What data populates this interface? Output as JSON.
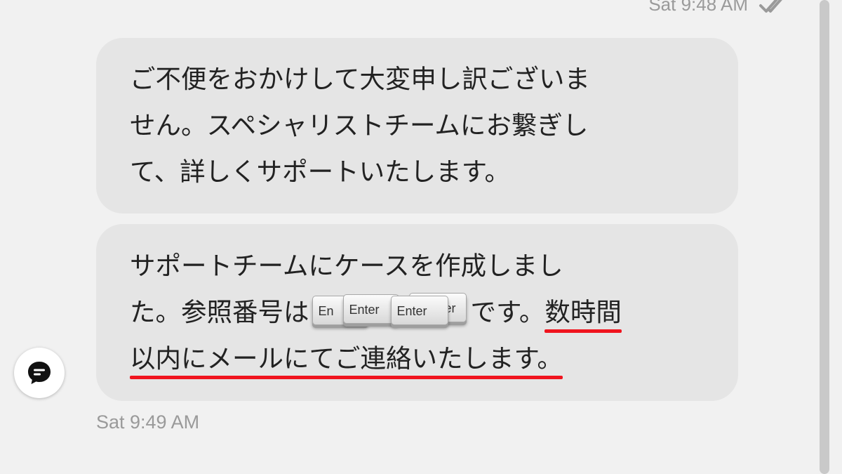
{
  "top_meta": {
    "timestamp": "Sat 9:48 AM",
    "status_icon": "double-check-icon"
  },
  "messages": [
    {
      "lines": [
        "ご不便をおかけして大変申し訳ございま",
        "せん。スペシャリストチームにお繋ぎし",
        "て、詳しくサポートいたします。"
      ]
    },
    {
      "line1": "サポートチームにケースを作成しまし",
      "line2_prefix": "た。参照番号は",
      "line2_suffix": "です。",
      "line2_highlight": "数時間",
      "line3_highlight": "以内にメールにてご連絡いたします。",
      "redaction_keys": [
        "En",
        "Enter",
        "Enter",
        "er"
      ]
    }
  ],
  "bot_icon": "chat-bubble-icon",
  "bottom_timestamp": "Sat 9:49 AM",
  "colors": {
    "background": "#f1f1f1",
    "bubble": "#e5e5e5",
    "underline": "#f0141e",
    "timestamp": "#9a9a9a"
  }
}
